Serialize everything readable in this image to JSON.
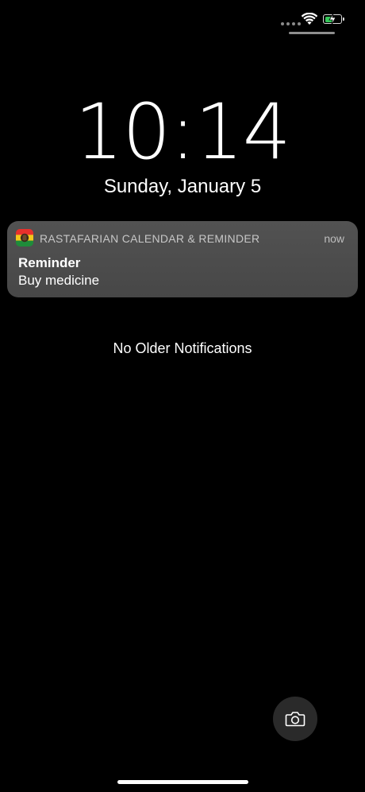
{
  "status_bar": {
    "icons": [
      "cellular-signal-icon",
      "wifi-icon",
      "battery-charging-icon"
    ],
    "battery_color": "#35c759",
    "battery_level": 0.5
  },
  "lock_screen": {
    "time": "10:14",
    "date": "Sunday, January 5"
  },
  "notification": {
    "app_icon": "rastafarian-flag-icon",
    "app_name": "RASTAFARIAN  CALENDAR & REMINDER",
    "time": "now",
    "title": "Reminder",
    "body": "Buy medicine"
  },
  "no_older_notifications": "No Older Notifications",
  "camera": {
    "icon": "camera-icon"
  }
}
